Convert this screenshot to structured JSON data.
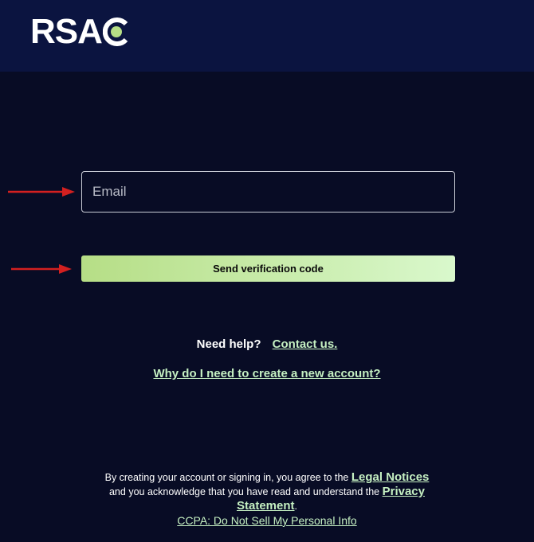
{
  "header": {
    "logo_text": "RSAC",
    "logo_tm": "™"
  },
  "form": {
    "email_placeholder": "Email",
    "send_button_label": "Send verification code"
  },
  "help": {
    "prompt": "Need help?",
    "contact_link": "Contact us.",
    "why_link": "Why do I need to create a new account?"
  },
  "legal": {
    "text_1": "By creating your account or signing in, you agree to the ",
    "legal_notices_link": "Legal Notices",
    "text_2": "and you acknowledge that you have read and understand the ",
    "privacy_link": "Privacy Statement",
    "text_3": ".",
    "ccpa_link": "CCPA: Do Not Sell My Personal Info"
  },
  "icons": {
    "logo_mark": "rsac-c-dot-mark",
    "arrows": [
      "red-arrow-right-icon",
      "red-arrow-right-icon"
    ]
  },
  "colors": {
    "page_background": "#080c25",
    "header_background": "#0b1440",
    "accent_green": "#b6de86",
    "link_green": "#c5f0c2",
    "arrow_red": "#d32020"
  }
}
